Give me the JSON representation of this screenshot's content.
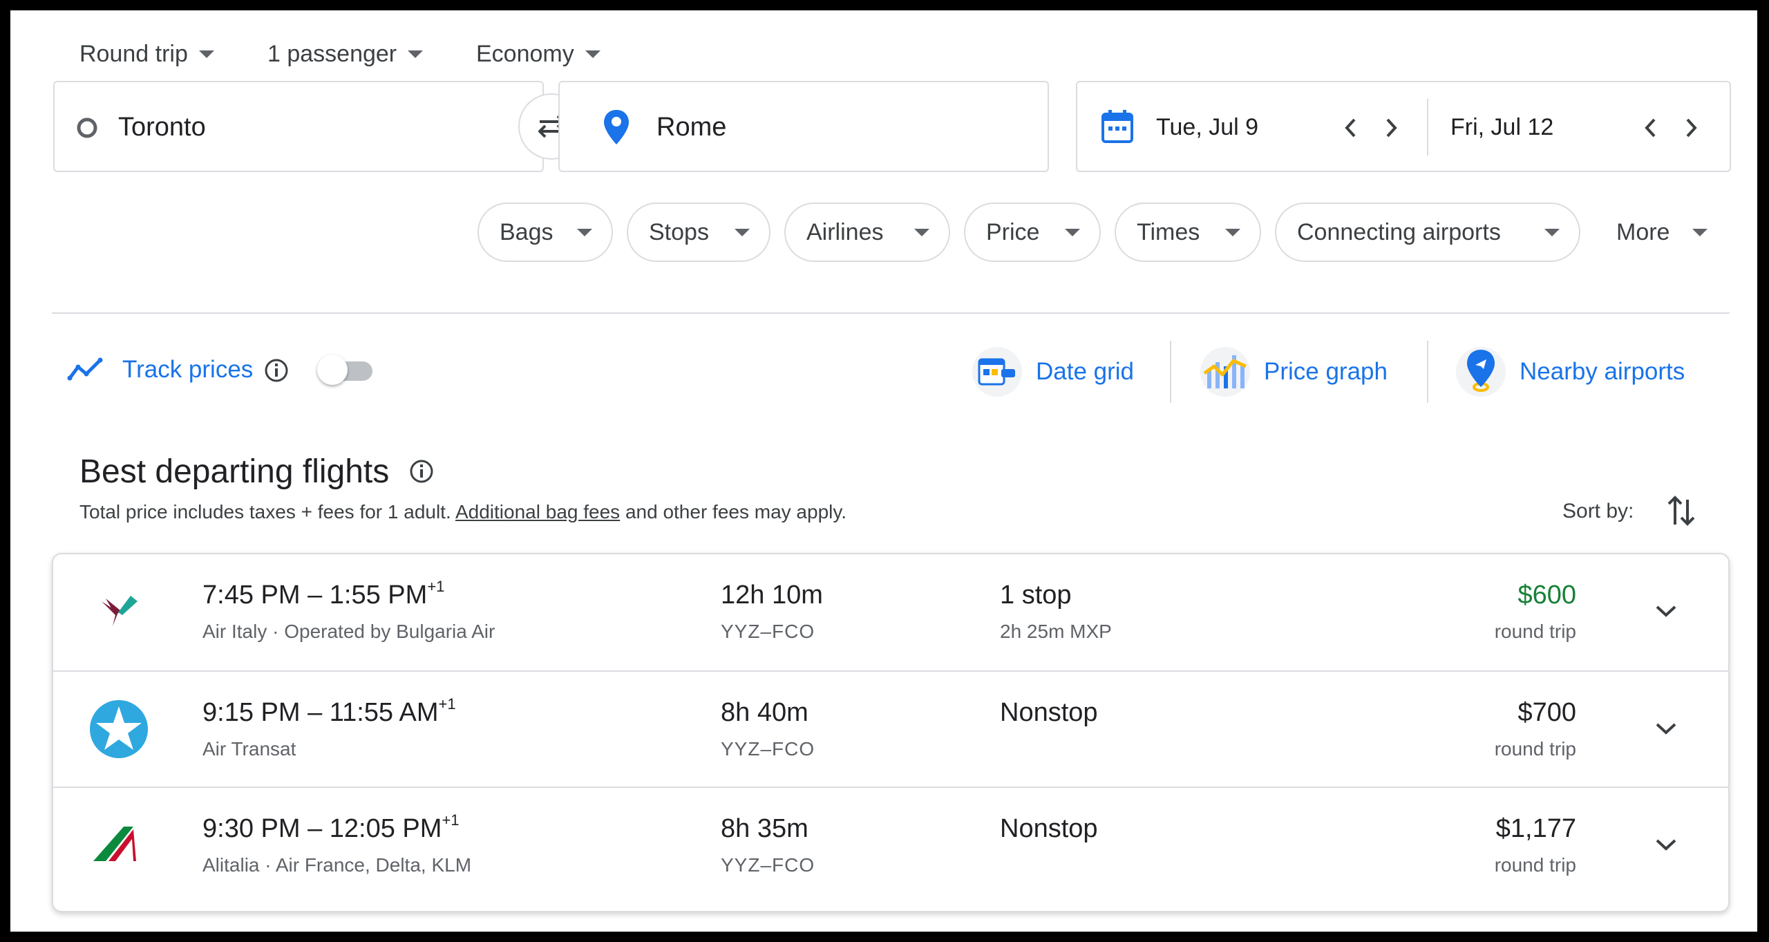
{
  "trip": {
    "type_label": "Round trip",
    "passengers_label": "1 passenger",
    "class_label": "Economy"
  },
  "search": {
    "origin": "Toronto",
    "destination": "Rome",
    "depart_date": "Tue, Jul 9",
    "return_date": "Fri, Jul 12"
  },
  "filters": [
    "Bags",
    "Stops",
    "Airlines",
    "Price",
    "Times",
    "Connecting airports",
    "More"
  ],
  "tools": {
    "track_prices": "Track prices",
    "track_enabled": false,
    "date_grid": "Date grid",
    "price_graph": "Price graph",
    "nearby_airports": "Nearby airports"
  },
  "results": {
    "heading": "Best departing flights",
    "note_before": "Total price includes taxes + fees for 1 adult. ",
    "note_link": "Additional bag fees",
    "note_after": " and other fees may apply.",
    "sort_label": "Sort by:",
    "flights": [
      {
        "logo": "air-italy-logo",
        "depart": "7:45 PM",
        "arrive": "1:55 PM",
        "day_offset": "+1",
        "airline": "Air Italy · Operated by Bulgaria Air",
        "duration": "12h 10m",
        "route": "YYZ–FCO",
        "stops": "1 stop",
        "layover": "2h 25m MXP",
        "price": "$600",
        "price_color": "#188038",
        "price_type": "round trip"
      },
      {
        "logo": "air-transat-logo",
        "depart": "9:15 PM",
        "arrive": "11:55 AM",
        "day_offset": "+1",
        "airline": "Air Transat",
        "duration": "8h 40m",
        "route": "YYZ–FCO",
        "stops": "Nonstop",
        "layover": "",
        "price": "$700",
        "price_color": "#202124",
        "price_type": "round trip"
      },
      {
        "logo": "alitalia-logo",
        "depart": "9:30 PM",
        "arrive": "12:05 PM",
        "day_offset": "+1",
        "airline": "Alitalia ·  Air France, Delta, KLM",
        "duration": "8h 35m",
        "route": "YYZ–FCO",
        "stops": "Nonstop",
        "layover": "",
        "price": "$1,177",
        "price_color": "#202124",
        "price_type": "round trip"
      }
    ]
  }
}
